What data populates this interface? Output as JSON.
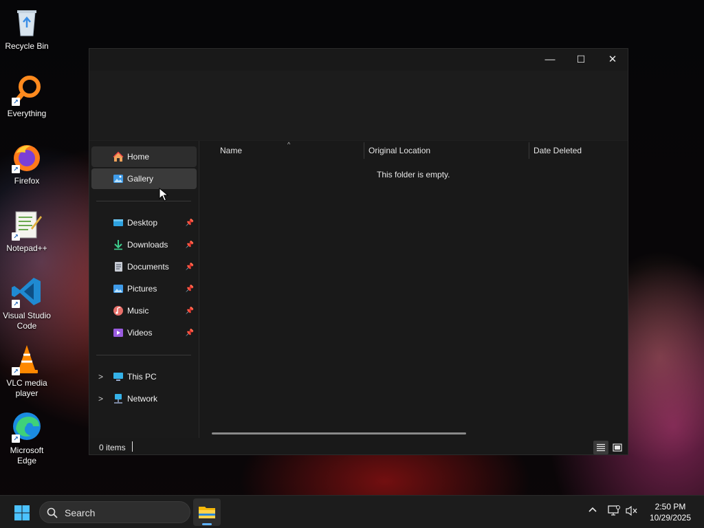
{
  "desktop": {
    "icons": [
      {
        "label": "Recycle Bin",
        "icon": "recycle-bin-icon"
      },
      {
        "label": "Everything",
        "icon": "everything-search-icon"
      },
      {
        "label": "Firefox",
        "icon": "firefox-icon"
      },
      {
        "label": "Notepad++",
        "icon": "notepad-plus-plus-icon"
      },
      {
        "label": "Visual Studio Code",
        "icon": "vscode-icon"
      },
      {
        "label": "VLC media player",
        "icon": "vlc-icon"
      },
      {
        "label": "Microsoft Edge",
        "icon": "edge-icon"
      }
    ]
  },
  "window": {
    "controls": {
      "minimize": "—",
      "maximize": "☐",
      "close": "✕"
    },
    "nav": {
      "home": "Home",
      "gallery": "Gallery",
      "quick_access": [
        {
          "label": "Desktop",
          "icon": "desktop-folder-icon",
          "pinned": true
        },
        {
          "label": "Downloads",
          "icon": "downloads-icon",
          "pinned": true
        },
        {
          "label": "Documents",
          "icon": "documents-icon",
          "pinned": true
        },
        {
          "label": "Pictures",
          "icon": "pictures-icon",
          "pinned": true
        },
        {
          "label": "Music",
          "icon": "music-icon",
          "pinned": true
        },
        {
          "label": "Videos",
          "icon": "videos-icon",
          "pinned": true
        }
      ],
      "this_pc": "This PC",
      "network": "Network"
    },
    "columns": {
      "name": "Name",
      "original_location": "Original Location",
      "date_deleted": "Date Deleted"
    },
    "empty_message": "This folder is empty.",
    "status": {
      "items": "0 items"
    }
  },
  "taskbar": {
    "search_placeholder": "Search",
    "clock": {
      "time": "2:50 PM",
      "date": "10/29/2025"
    }
  },
  "colors": {
    "accent": "#5fb2ff",
    "window_bg": "#191919",
    "taskbar_bg": "#1c1c1c"
  }
}
